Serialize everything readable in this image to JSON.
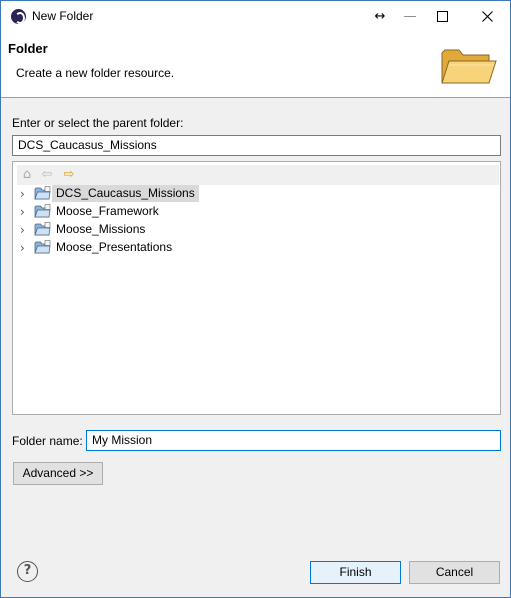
{
  "window": {
    "title": "New Folder",
    "controls": {
      "resize_icon": "↔",
      "minimize_icon": "—",
      "maximize_icon": "☐",
      "close_icon": "✕"
    }
  },
  "banner": {
    "title": "Folder",
    "description": "Create a new folder resource.",
    "graphic": "folder-icon"
  },
  "parent": {
    "label": "Enter or select the parent folder:",
    "value": "DCS_Caucasus_Missions"
  },
  "tree_toolbar": {
    "home_icon": "⌂",
    "back_icon": "⇦",
    "forward_icon": "⇨"
  },
  "tree": {
    "items": [
      {
        "label": "DCS_Caucasus_Missions",
        "selected": true
      },
      {
        "label": "Moose_Framework",
        "selected": false
      },
      {
        "label": "Moose_Missions",
        "selected": false
      },
      {
        "label": "Moose_Presentations",
        "selected": false
      }
    ],
    "expander_icon": "›"
  },
  "folder_name": {
    "label": "Folder name:",
    "value": "My Mission"
  },
  "buttons": {
    "advanced": "Advanced >>",
    "finish": "Finish",
    "cancel": "Cancel",
    "help": "?"
  },
  "colors": {
    "accent": "#0078d7",
    "selection": "#d9d9d9",
    "folder": "#f2c14e"
  }
}
